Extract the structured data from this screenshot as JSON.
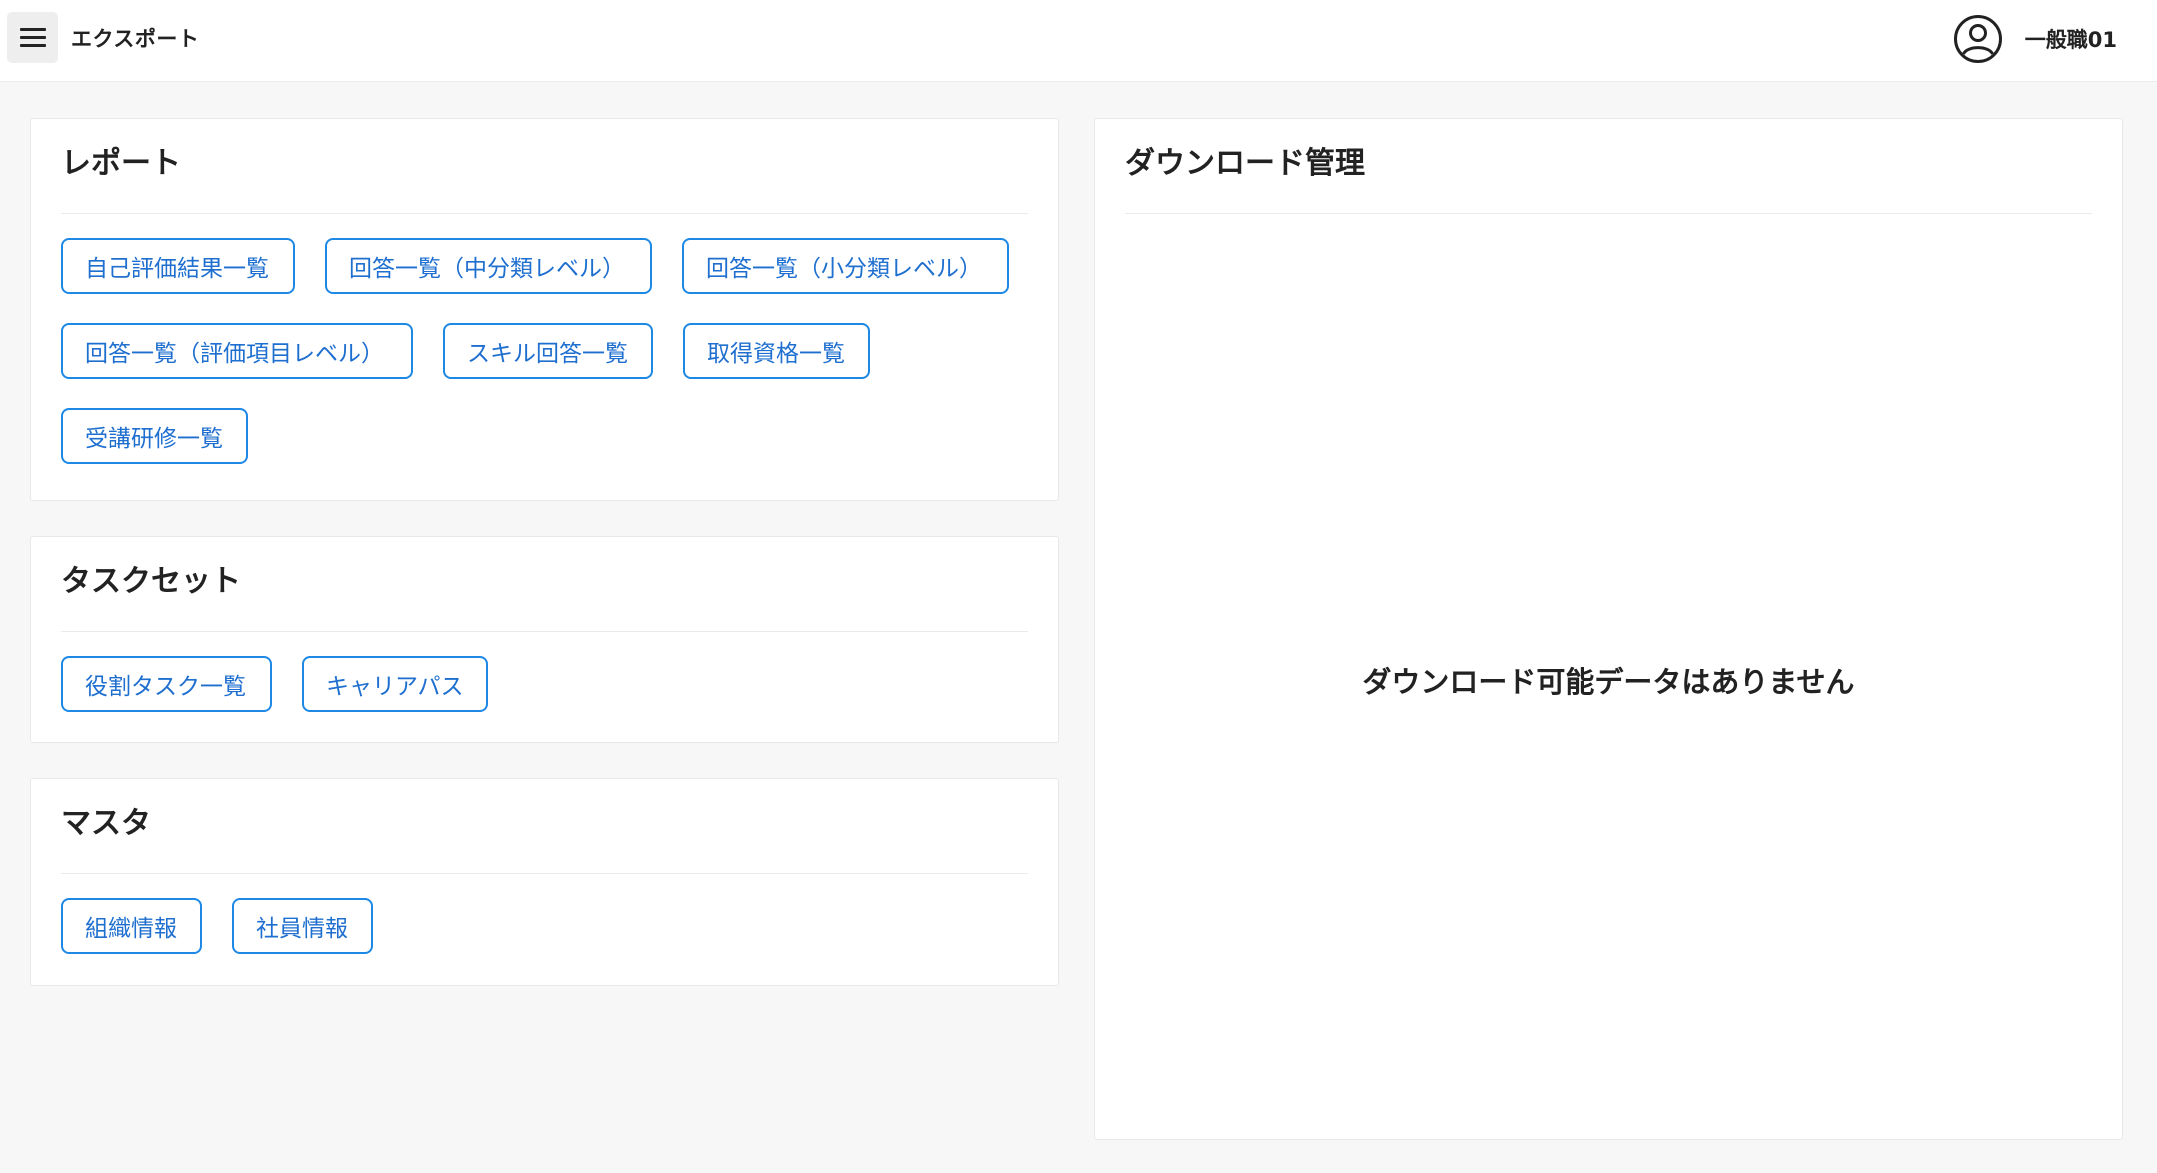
{
  "header": {
    "title": "エクスポート",
    "user_name": "一般職01"
  },
  "sections": {
    "report": {
      "title": "レポート",
      "buttons": [
        "自己評価結果一覧",
        "回答一覧（中分類レベル）",
        "回答一覧（小分類レベル）",
        "回答一覧（評価項目レベル）",
        "スキル回答一覧",
        "取得資格一覧",
        "受講研修一覧"
      ]
    },
    "taskset": {
      "title": "タスクセット",
      "buttons": [
        "役割タスク一覧",
        "キャリアパス"
      ]
    },
    "master": {
      "title": "マスタ",
      "buttons": [
        "組織情報",
        "社員情報"
      ]
    }
  },
  "download": {
    "title": "ダウンロード管理",
    "empty_message": "ダウンロード可能データはありません"
  },
  "colors": {
    "accent": "#1e88e5",
    "background": "#f7f7f7"
  }
}
